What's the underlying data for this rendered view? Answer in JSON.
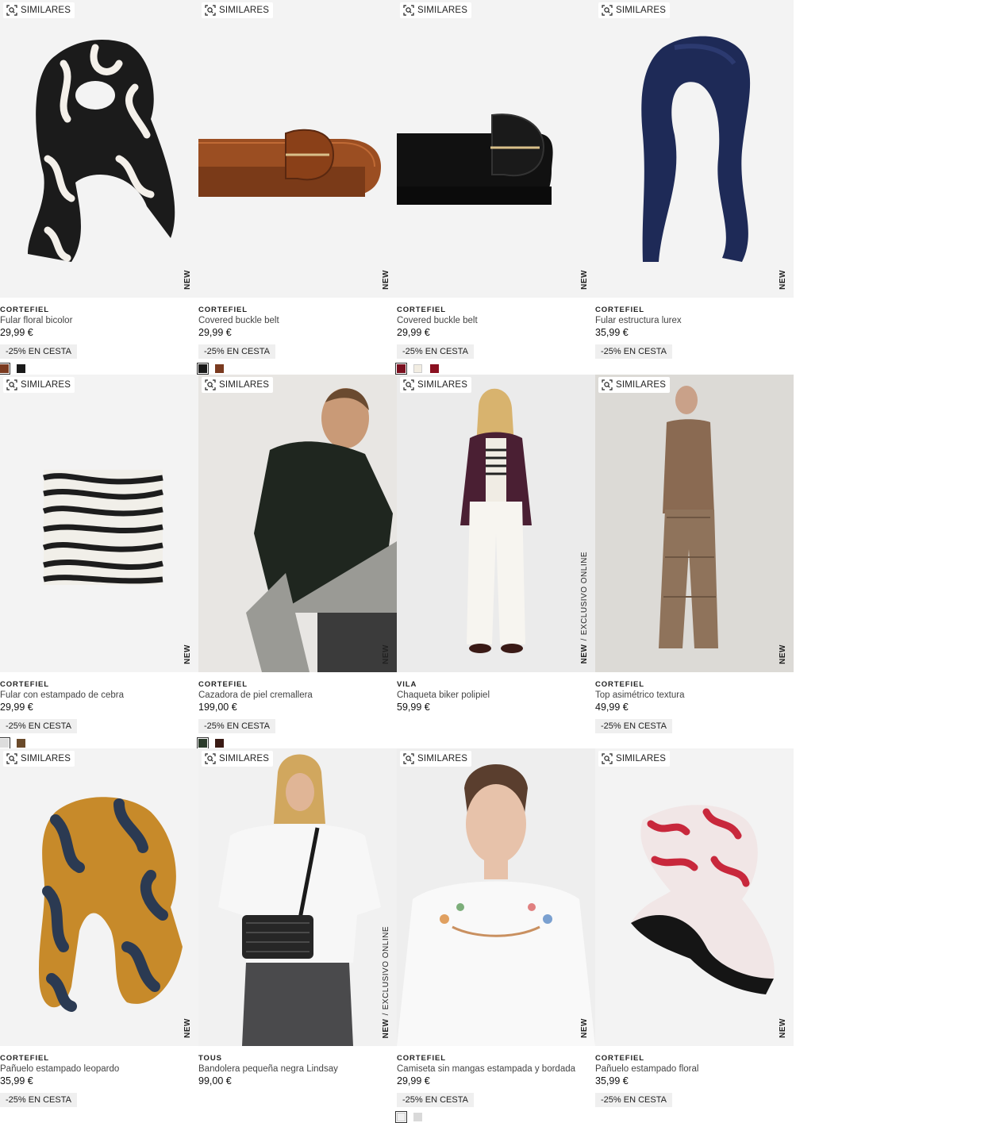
{
  "similar_label": "SIMILARES",
  "products": [
    {
      "brand": "CORTEFIEL",
      "name": "Fular floral bicolor",
      "price": "29,99 €",
      "promo": "-25% EN CESTA",
      "badge": "NEW",
      "exclusive": "",
      "swatches": [
        "#7a3a1f",
        "#1a1a1a"
      ],
      "image": "scarf-floral-icon"
    },
    {
      "brand": "CORTEFIEL",
      "name": "Covered buckle belt",
      "price": "29,99 €",
      "promo": "-25% EN CESTA",
      "badge": "NEW",
      "exclusive": "",
      "swatches": [
        "#1a1a1a",
        "#7a3a1f"
      ],
      "image": "belt-brown-icon"
    },
    {
      "brand": "CORTEFIEL",
      "name": "Covered buckle belt",
      "price": "29,99 €",
      "promo": "-25% EN CESTA",
      "badge": "NEW",
      "exclusive": "",
      "swatches": [
        "#7a1020",
        "#f2ede2",
        "#8a1020"
      ],
      "image": "belt-black-icon"
    },
    {
      "brand": "CORTEFIEL",
      "name": "Fular estructura lurex",
      "price": "35,99 €",
      "promo": "-25% EN CESTA",
      "badge": "NEW",
      "exclusive": "",
      "swatches": [],
      "image": "scarf-navy-icon"
    },
    {
      "brand": "CORTEFIEL",
      "name": "Fular con estampado de cebra",
      "price": "29,99 €",
      "promo": "-25% EN CESTA",
      "badge": "NEW",
      "exclusive": "",
      "swatches": [
        "#dddddd",
        "#6a4a2a"
      ],
      "image": "scarf-zebra-icon"
    },
    {
      "brand": "CORTEFIEL",
      "name": "Cazadora de piel cremallera",
      "price": "199,00 €",
      "promo": "-25% EN CESTA",
      "badge": "NEW",
      "exclusive": "",
      "swatches": [
        "#2a3a2a",
        "#3a1a14"
      ],
      "image": "leather-jacket-model-icon"
    },
    {
      "brand": "VILA",
      "name": "Chaqueta biker polipiel",
      "price": "59,99 €",
      "promo": "",
      "badge": "NEW",
      "exclusive": "EXCLUSIVO ONLINE",
      "swatches": [],
      "image": "biker-jacket-model-icon"
    },
    {
      "brand": "CORTEFIEL",
      "name": "Top asimétrico textura",
      "price": "49,99 €",
      "promo": "-25% EN CESTA",
      "badge": "NEW",
      "exclusive": "",
      "swatches": [],
      "image": "textured-top-model-icon"
    },
    {
      "brand": "CORTEFIEL",
      "name": "Pañuelo estampado leopardo",
      "price": "35,99 €",
      "promo": "-25% EN CESTA",
      "badge": "NEW",
      "exclusive": "",
      "swatches": [],
      "image": "scarf-leopard-icon"
    },
    {
      "brand": "TOUS",
      "name": "Bandolera pequeña negra Lindsay",
      "price": "99,00 €",
      "promo": "",
      "badge": "NEW",
      "exclusive": "EXCLUSIVO ONLINE",
      "swatches": [],
      "image": "crossbody-bag-model-icon"
    },
    {
      "brand": "CORTEFIEL",
      "name": "Camiseta sin mangas estampada y bordada",
      "price": "29,99 €",
      "promo": "-25% EN CESTA",
      "badge": "NEW",
      "exclusive": "",
      "swatches": [
        "#f0f0f0",
        "#d9d9d9"
      ],
      "image": "embroidered-tee-model-icon"
    },
    {
      "brand": "CORTEFIEL",
      "name": "Pañuelo estampado floral",
      "price": "35,99 €",
      "promo": "-25% EN CESTA",
      "badge": "NEW",
      "exclusive": "",
      "swatches": [],
      "image": "scarf-red-floral-icon"
    }
  ]
}
